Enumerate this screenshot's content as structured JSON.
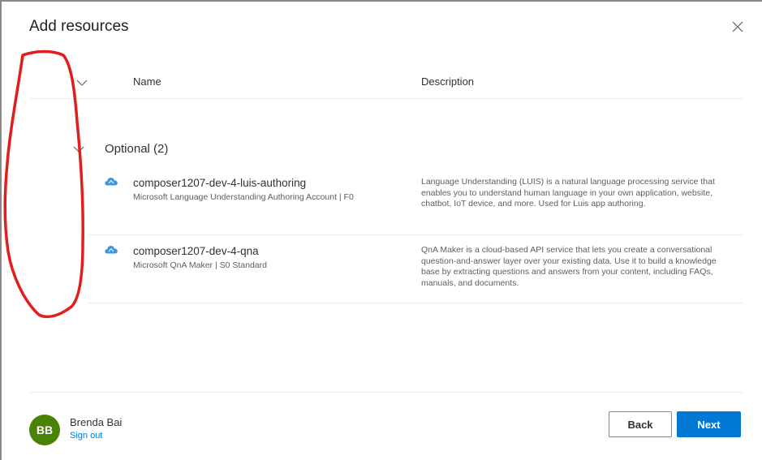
{
  "dialog": {
    "title": "Add resources",
    "close_icon": "close-icon"
  },
  "table": {
    "columns": [
      "Name",
      "Description"
    ],
    "header_toggle_icon": "chevron-down-icon"
  },
  "group": {
    "label": "Optional (2)",
    "toggle_icon": "chevron-down-icon"
  },
  "resources": [
    {
      "icon": "cognitive-services-cloud-icon",
      "name": "composer1207-dev-4-luis-authoring",
      "subtitle": "Microsoft Language Understanding Authoring Account | F0",
      "description": "Language Understanding (LUIS) is a natural language processing service that enables you to understand human language in your own application, website, chatbot, IoT device, and more. Used for Luis app authoring."
    },
    {
      "icon": "cognitive-services-cloud-icon",
      "name": "composer1207-dev-4-qna",
      "subtitle": "Microsoft QnA Maker | S0 Standard",
      "description": "QnA Maker is a cloud-based API service that lets you create a conversational question-and-answer layer over your existing data. Use it to build a knowledge base by extracting questions and answers from your content, including FAQs, manuals, and documents."
    }
  ],
  "user": {
    "initials": "BB",
    "name": "Brenda Bai",
    "sign_out_label": "Sign out",
    "avatar_color": "#498205"
  },
  "footer": {
    "back_label": "Back",
    "next_label": "Next"
  },
  "colors": {
    "accent": "#0078d4",
    "annotation": "#e11d1d",
    "icon_blue": "#3a96dd"
  }
}
